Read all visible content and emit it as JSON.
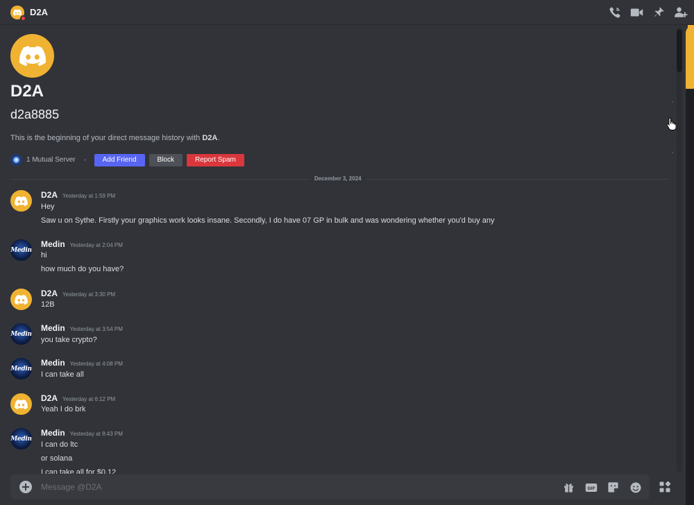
{
  "header": {
    "title": "D2A"
  },
  "intro": {
    "name": "D2A",
    "username": "d2a8885",
    "description_prefix": "This is the beginning of your direct message history with ",
    "description_name": "D2A",
    "description_suffix": ".",
    "mutual_servers": "1 Mutual Server",
    "add_friend": "Add Friend",
    "block": "Block",
    "report_spam": "Report Spam"
  },
  "divider": {
    "date": "December 3, 2024"
  },
  "messages": [
    {
      "author": "D2A",
      "time": "Yesterday at 1:59 PM",
      "lines": [
        "Hey",
        "Saw u on Sythe. Firstly your graphics work looks insane. Secondly, I do have 07 GP in bulk and was wondering whether you'd buy any"
      ]
    },
    {
      "author": "Medin",
      "time": "Yesterday at 2:04 PM",
      "lines": [
        "hi",
        "how much do you have?"
      ]
    },
    {
      "author": "D2A",
      "time": "Yesterday at 3:30 PM",
      "lines": [
        "12B"
      ]
    },
    {
      "author": "Medin",
      "time": "Yesterday at 3:54 PM",
      "lines": [
        "you take crypto?"
      ]
    },
    {
      "author": "Medin",
      "time": "Yesterday at 4:08 PM",
      "lines": [
        "I can take all"
      ]
    },
    {
      "author": "D2A",
      "time": "Yesterday at 6:12 PM",
      "lines": [
        "Yeah I do brk"
      ]
    },
    {
      "author": "Medin",
      "time": "Yesterday at 8:43 PM",
      "lines": [
        "I can do ltc",
        "or solana",
        "I can take all for $0.12"
      ]
    }
  ],
  "avatars": {
    "medin_text": "Medin"
  },
  "composer": {
    "placeholder": "Message @D2A"
  },
  "colors": {
    "accent": "#f0b232",
    "blurple": "#5865f2",
    "danger": "#da373c",
    "background": "#313338"
  }
}
